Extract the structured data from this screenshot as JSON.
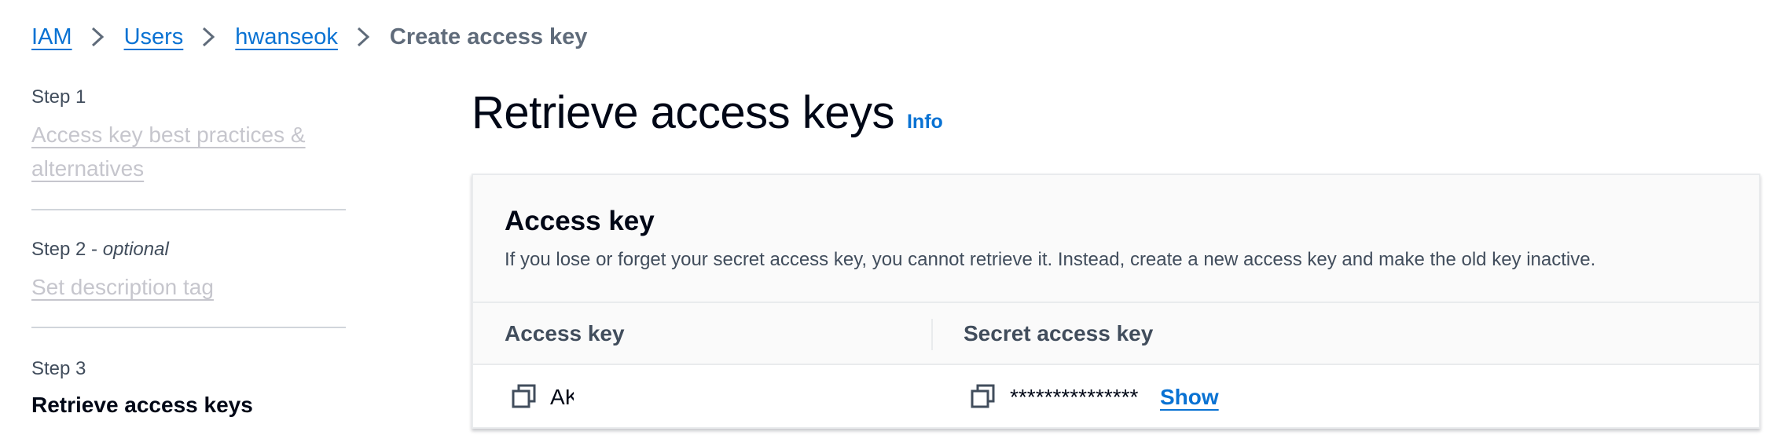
{
  "breadcrumb": {
    "items": [
      "IAM",
      "Users",
      "hwanseok"
    ],
    "current": "Create access key"
  },
  "steps": [
    {
      "title": "Step 1",
      "optional": "",
      "label": "Access key best practices & alternatives"
    },
    {
      "title": "Step 2",
      "optional": "optional",
      "label": "Set description tag"
    },
    {
      "title": "Step 3",
      "optional": "",
      "label": "Retrieve access keys"
    }
  ],
  "page": {
    "title": "Retrieve access keys",
    "info_label": "Info"
  },
  "panel": {
    "title": "Access key",
    "description": "If you lose or forget your secret access key, you cannot retrieve it. Instead, create a new access key and make the old key inactive.",
    "columns": [
      "Access key",
      "Secret access key"
    ],
    "row": {
      "access_key": "AK",
      "secret_key": "***************",
      "show_label": "Show"
    }
  },
  "icons": {
    "chevron": "chevron-right-icon",
    "copy": "copy-icon"
  },
  "colors": {
    "link": "#0972d3",
    "disabled_link": "#c6c6cd",
    "text": "#000716",
    "secondary_text": "#414d5c"
  }
}
